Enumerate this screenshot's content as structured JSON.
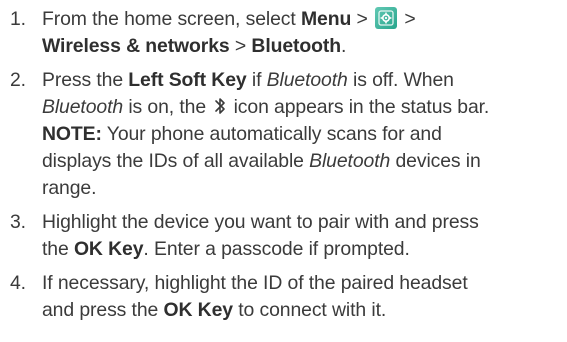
{
  "steps": [
    {
      "number": "1.",
      "lines": [
        {
          "a": "From the home screen, select ",
          "menu": "Menu",
          "sep1": " > ",
          "icon": "settings-icon",
          "sep2": " >"
        },
        {
          "wireless": "Wireless & networks",
          "sep": " > ",
          "bluetooth": "Bluetooth",
          "end": "."
        }
      ]
    },
    {
      "number": "2.",
      "lines": [
        {
          "a": "Press the ",
          "key": "Left Soft Key",
          "b": " if ",
          "it": "Bluetooth",
          "c": " is off. When"
        },
        {
          "it": "Bluetooth",
          "a": " is on, the ",
          "icon": "bluetooth-icon",
          "b": " icon appears in the status bar."
        },
        {
          "note": "NOTE:",
          "a": " Your phone automatically scans for and"
        },
        {
          "a": "displays the IDs of all available ",
          "it": "Bluetooth",
          "b": " devices in"
        },
        {
          "a": "range."
        }
      ]
    },
    {
      "number": "3.",
      "lines": [
        {
          "a": "Highlight the device you want to pair with and press"
        },
        {
          "a": "the ",
          "key": "OK Key",
          "b": ". Enter a passcode if prompted."
        }
      ]
    },
    {
      "number": "4.",
      "lines": [
        {
          "a": "If necessary, highlight the ID of the paired headset"
        },
        {
          "a": "and press the ",
          "key": "OK Key",
          "b": " to connect with it."
        }
      ]
    }
  ],
  "colors": {
    "text": "#3b3b3b",
    "settings_icon_bg": "#2fae95"
  }
}
